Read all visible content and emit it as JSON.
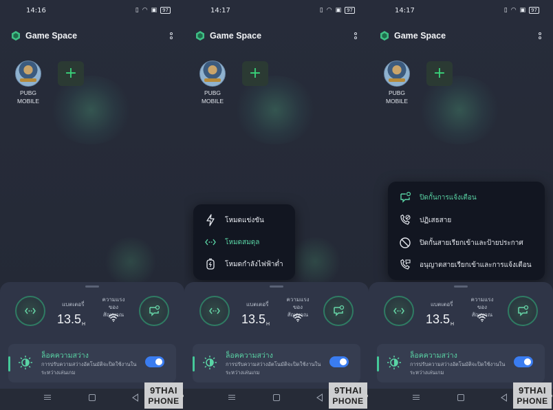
{
  "screens": [
    {
      "status": {
        "time": "14:16",
        "battery": "97"
      },
      "app_title": "Game Space",
      "game": {
        "name_line1": "PUBG",
        "name_line2": "MOBILE"
      },
      "add_label": "+",
      "panel": {
        "battery_label": "แบตเตอรี่",
        "battery_value": "13.5",
        "battery_unit": "H",
        "signal_label": "ความแรงของสัญญาณ",
        "lock_title": "ล็อคความสว่าง",
        "lock_desc": "การปรับความสว่างอัตโนมัติจะปิดใช้งานในระหว่างเล่นเกม",
        "lock_enabled": true
      }
    },
    {
      "status": {
        "time": "14:17",
        "battery": "97"
      },
      "app_title": "Game Space",
      "game": {
        "name_line1": "PUBG",
        "name_line2": "MOBILE"
      },
      "add_label": "+",
      "panel": {
        "battery_label": "แบตเตอรี่",
        "battery_value": "13.5",
        "battery_unit": "H",
        "signal_label": "ความแรงของสัญญาณ",
        "lock_title": "ล็อคความสว่าง",
        "lock_desc": "การปรับความสว่างอัตโนมัติจะปิดใช้งานในระหว่างเล่นเกม",
        "lock_enabled": true
      },
      "popup": {
        "items": [
          {
            "label": "โหมดแข่งขัน",
            "icon": "lightning-icon",
            "active": false
          },
          {
            "label": "โหมดสมดุล",
            "icon": "balance-icon",
            "active": true
          },
          {
            "label": "โหมดกำลังไฟฟ้าต่ำ",
            "icon": "low-power-icon",
            "active": false
          }
        ]
      }
    },
    {
      "status": {
        "time": "14:17",
        "battery": "97"
      },
      "app_title": "Game Space",
      "game": {
        "name_line1": "PUBG",
        "name_line2": "MOBILE"
      },
      "add_label": "+",
      "panel": {
        "battery_label": "แบตเตอรี่",
        "battery_value": "13.5",
        "battery_unit": "H",
        "signal_label": "ความแรงของสัญญาณ",
        "lock_title": "ล็อคความสว่าง",
        "lock_desc": "การปรับความสว่างอัตโนมัติจะปิดใช้งานในระหว่างเล่นเกม",
        "lock_enabled": true
      },
      "popup": {
        "items": [
          {
            "label": "ปิดกั้นการแจ้งเตือน",
            "icon": "block-notification-icon",
            "active": true
          },
          {
            "label": "ปฏิเสธสาย",
            "icon": "reject-call-icon",
            "active": false
          },
          {
            "label": "ปิดกั้นสายเรียกเข้าและป้ายประกาศ",
            "icon": "block-icon",
            "active": false
          },
          {
            "label": "อนุญาตสายเรียกเข้าและการแจ้งเตือน",
            "icon": "allow-call-icon",
            "active": false
          }
        ]
      }
    }
  ],
  "watermark": {
    "line1": "9THAI",
    "line2": "PHONE"
  },
  "colors": {
    "accent": "#5ad4a5",
    "toggle": "#3a7cf0",
    "plus": "#39d37a",
    "background": "#272c3a"
  }
}
